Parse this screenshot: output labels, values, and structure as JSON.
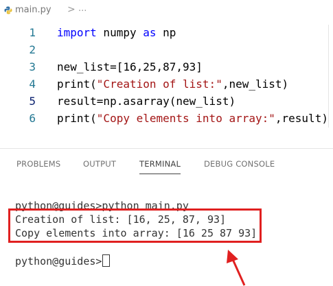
{
  "breadcrumb": {
    "file_name": "main.py",
    "separator": ">",
    "more": "..."
  },
  "editor": {
    "lines": [
      {
        "number": "1",
        "tokens": [
          {
            "t": "import",
            "c": "kw"
          },
          {
            "t": " numpy ",
            "c": ""
          },
          {
            "t": "as",
            "c": "kw"
          },
          {
            "t": " np",
            "c": ""
          }
        ]
      },
      {
        "number": "2",
        "tokens": []
      },
      {
        "number": "3",
        "tokens": [
          {
            "t": "new_list=[16,25,87,93]",
            "c": ""
          }
        ]
      },
      {
        "number": "4",
        "tokens": [
          {
            "t": "print(",
            "c": ""
          },
          {
            "t": "\"Creation of list:\"",
            "c": "str"
          },
          {
            "t": ",new_list)",
            "c": ""
          }
        ]
      },
      {
        "number": "5",
        "tokens": [
          {
            "t": "result=np.asarray(new_list)",
            "c": ""
          }
        ]
      },
      {
        "number": "6",
        "tokens": [
          {
            "t": "print(",
            "c": ""
          },
          {
            "t": "\"Copy elements into array:\"",
            "c": "str"
          },
          {
            "t": ",result)",
            "c": ""
          }
        ]
      }
    ],
    "active_line": "5"
  },
  "panel": {
    "tabs": [
      {
        "label": "PROBLEMS",
        "active": false
      },
      {
        "label": "OUTPUT",
        "active": false
      },
      {
        "label": "TERMINAL",
        "active": true
      },
      {
        "label": "DEBUG CONSOLE",
        "active": false
      }
    ]
  },
  "terminal": {
    "command_line": "python@guides>python main.py",
    "output_1": "Creation of list: [16, 25, 87, 93]",
    "output_2": "Copy elements into array: [16 25 87 93]",
    "prompt": "python@guides>"
  },
  "colors": {
    "keyword": "#0000ff",
    "string": "#a31515",
    "line_number": "#237893",
    "annotation": "#e02020"
  }
}
